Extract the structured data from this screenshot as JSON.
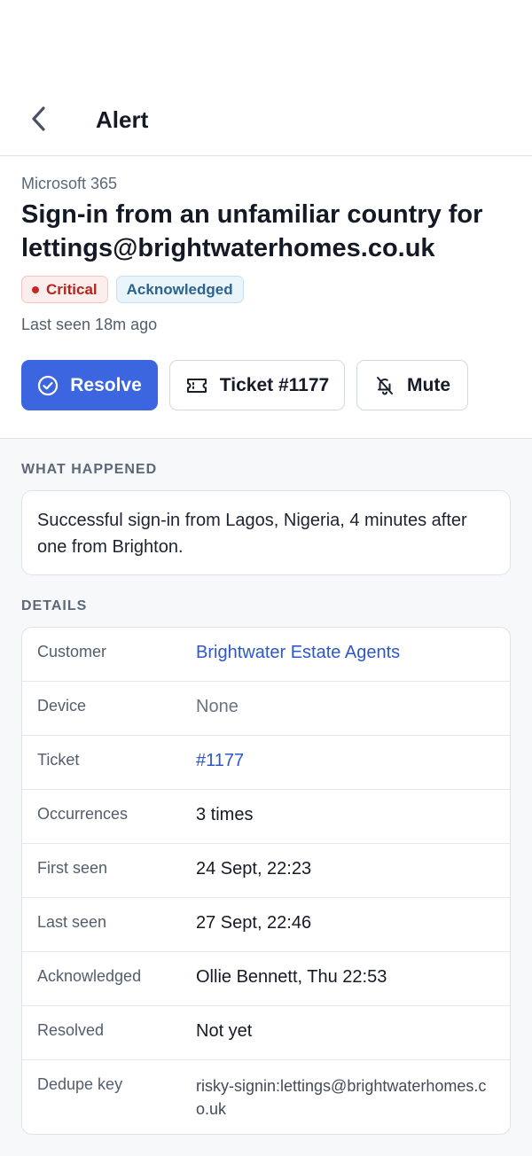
{
  "header": {
    "title": "Alert"
  },
  "alert": {
    "source": "Microsoft 365",
    "title": "Sign-in from an unfamiliar country for lettings@brightwaterhomes.co.uk",
    "badges": {
      "severity": "Critical",
      "status": "Acknowledged"
    },
    "last_seen": "Last seen 18m ago"
  },
  "actions": {
    "resolve": "Resolve",
    "ticket": "Ticket #1177",
    "mute": "Mute"
  },
  "what_happened": {
    "label": "WHAT HAPPENED",
    "text": "Successful sign-in from Lagos, Nigeria, 4 minutes after one from Brighton."
  },
  "details": {
    "label": "DETAILS",
    "rows": [
      {
        "label": "Customer",
        "value": "Brightwater Estate Agents"
      },
      {
        "label": "Device",
        "value": "None"
      },
      {
        "label": "Ticket",
        "value": "#1177"
      },
      {
        "label": "Occurrences",
        "value": "3 times"
      },
      {
        "label": "First seen",
        "value": "24 Sept, 22:23"
      },
      {
        "label": "Last seen",
        "value": "27 Sept, 22:46"
      },
      {
        "label": "Acknowledged",
        "value": "Ollie Bennett, Thu 22:53"
      },
      {
        "label": "Resolved",
        "value": "Not yet"
      },
      {
        "label": "Dedupe key",
        "value": "risky-signin:lettings@brightwaterhomes.co.uk"
      }
    ]
  },
  "colors": {
    "primary": "#3b66e0",
    "link": "#2e57c8",
    "critical": "#b3261e",
    "acknowledged": "#2a6390"
  },
  "icons": {
    "back": "chevron-left-icon",
    "resolve": "check-circle-icon",
    "ticket": "ticket-icon",
    "mute": "bell-off-icon"
  }
}
